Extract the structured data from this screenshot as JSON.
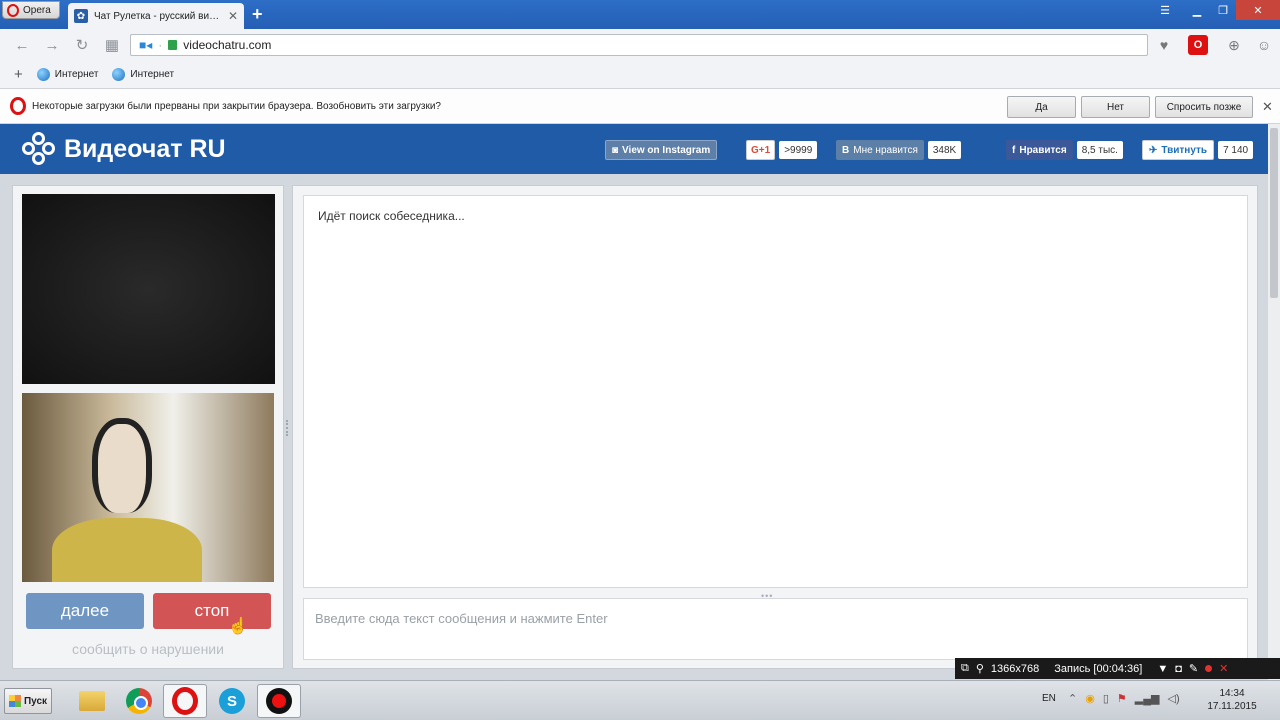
{
  "browser": {
    "menu_label": "Opera",
    "tab_title": "Чат Рулетка - русский видео",
    "url": "videochatru.com",
    "bookmarks": [
      "Интернет",
      "Интернет"
    ]
  },
  "notice": {
    "text": "Некоторые загрузки были прерваны при закрытии браузера. Возобновить эти загрузки?",
    "yes": "Да",
    "no": "Нет",
    "later": "Спросить позже"
  },
  "site": {
    "title": "Видеочат RU",
    "instagram": "View on Instagram",
    "gplus_label": "G+1",
    "gplus_count": ">9999",
    "vk_label": "Мне нравится",
    "vk_count": "348K",
    "fb_label": "Нравится",
    "fb_count": "8,5 тыс.",
    "tw_label": "Твитнуть",
    "tw_count": "7 140"
  },
  "chat": {
    "status": "Идёт поиск собеседника...",
    "input_placeholder": "Введите сюда текст сообщения и нажмите Enter",
    "next_button": "далее",
    "stop_button": "стоп",
    "report_link": "сообщить о нарушении"
  },
  "recorder": {
    "resolution": "1366x768",
    "status": "Запись [00:04:36]"
  },
  "taskbar": {
    "start": "Пуск",
    "lang": "EN",
    "time": "14:34",
    "date": "17.11.2015"
  },
  "colors": {
    "header": "#1f5ba7",
    "next_button": "#6f95c2",
    "stop_button": "#d35454"
  }
}
